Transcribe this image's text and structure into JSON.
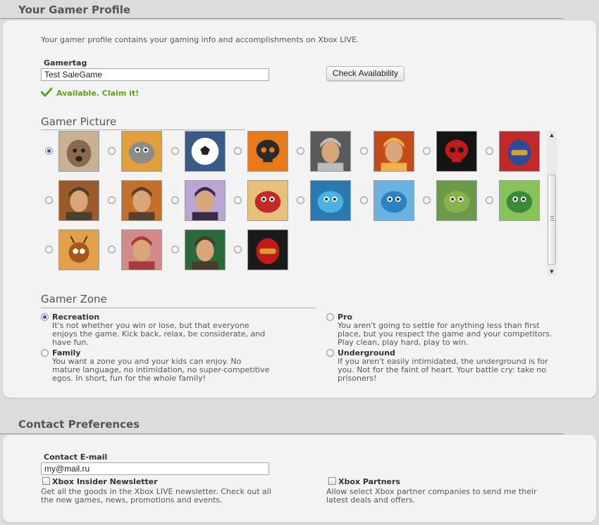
{
  "profile": {
    "title": "Your Gamer Profile",
    "intro": "Your gamer profile contains your gaming info and accomplishments on Xbox LIVE.",
    "gamertag_label": "Gamertag",
    "gamertag_value": "Test SaleGame",
    "check_button": "Check Availability",
    "availability": "Available. Claim it!",
    "accent_green": "#5fa020"
  },
  "gamer_picture": {
    "title": "Gamer Picture",
    "selected_index": 0,
    "pictures": [
      "dog-face-avatar",
      "grey-alien-mascot-avatar",
      "soccer-ball-avatar",
      "skull-emblem-avatar",
      "armored-warrior-avatar",
      "spiky-hair-hero-avatar",
      "red-skull-gears-avatar",
      "blue-spartan-helmet-avatar",
      "soldier-in-fire-avatar",
      "soldier-portrait-avatar",
      "elf-girl-avatar",
      "red-dragon-avatar",
      "blue-fish-monster-avatar",
      "blue-slug-creature-avatar",
      "green-goblin-avatar",
      "green-fish-creature-avatar",
      "orange-robot-bug-avatar",
      "red-hair-woman-avatar",
      "jungle-woman-avatar",
      "racing-helmet-avatar"
    ]
  },
  "gamer_zone": {
    "title": "Gamer Zone",
    "selected": "Recreation",
    "zones": [
      {
        "name": "Recreation",
        "desc": "It's not whether you win or lose, but that everyone enjoys the game. Kick back, relax, be considerate, and have fun."
      },
      {
        "name": "Pro",
        "desc": "You aren't going to settle for anything less than first place, but you respect the game and your competitors. Play clean, play hard, play to win."
      },
      {
        "name": "Family",
        "desc": "You want a zone you and your kids can enjoy. No mature language, no intimidation, no super-competitive egos. In short, fun for the whole family!"
      },
      {
        "name": "Underground",
        "desc": "If you aren't easily intimidated, the underground is for you. Not for the faint of heart. Your battle cry: take no prisoners!"
      }
    ]
  },
  "contact": {
    "title": "Contact Preferences",
    "email_label": "Contact E-mail",
    "email_value": "my@mail.ru",
    "newsletter_title": "Xbox Insider Newsletter",
    "newsletter_desc": "Get all the goods in the Xbox LIVE newsletter. Check out all the new games, news, promotions and events.",
    "partners_title": "Xbox Partners",
    "partners_desc": "Allow select Xbox partner companies to send me their latest deals and offers."
  }
}
